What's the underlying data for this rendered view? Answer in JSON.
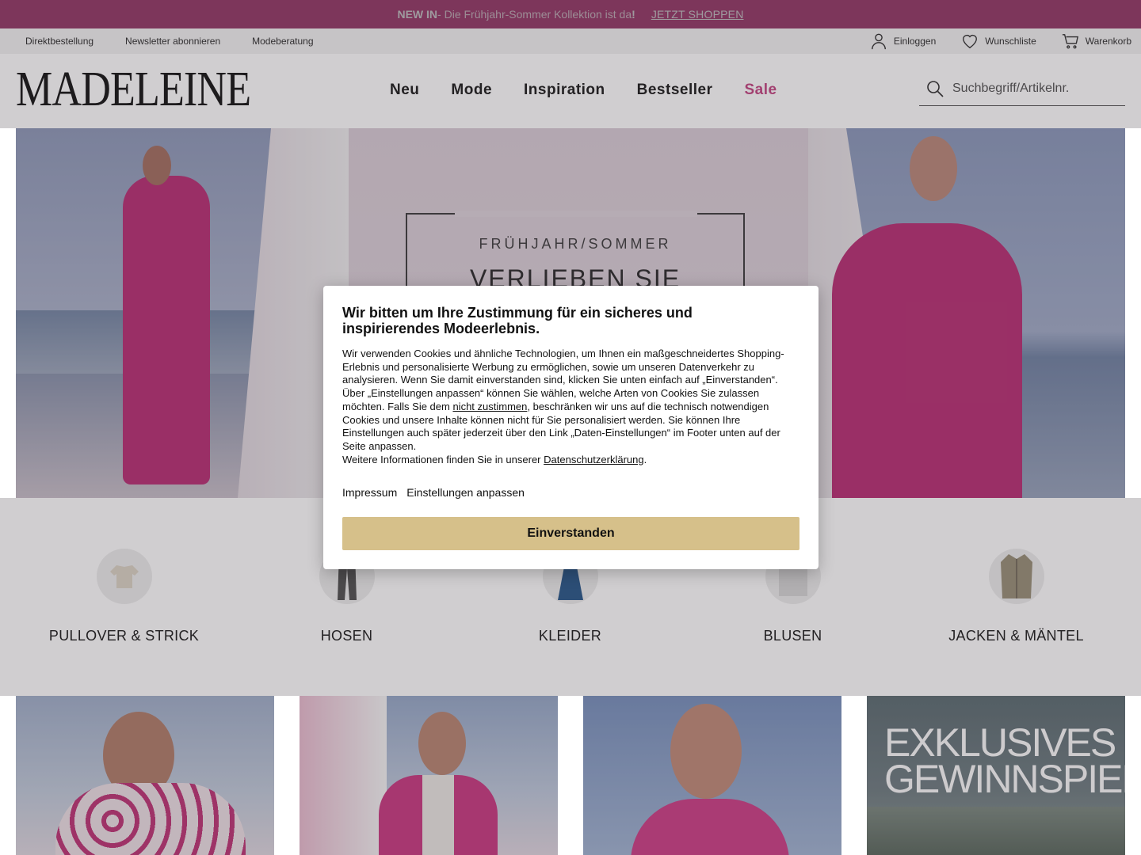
{
  "promo": {
    "new_in": "NEW IN",
    "text": " - Die Frühjahr-Sommer Kollektion ist da",
    "exclamation": "!",
    "cta": "JETZT SHOPPEN"
  },
  "service": {
    "links": [
      "Direktbestellung",
      "Newsletter abonnieren",
      "Modeberatung"
    ],
    "login": "Einloggen",
    "wishlist": "Wunschliste",
    "cart": "Warenkorb"
  },
  "header": {
    "logo": "MADELEINE",
    "nav": [
      "Neu",
      "Mode",
      "Inspiration",
      "Bestseller",
      "Sale"
    ],
    "search_placeholder": "Suchbegriff/Artikelnr."
  },
  "hero": {
    "kicker": "FRÜHJAHR/SOMMER",
    "title": "VERLIEBEN SIE"
  },
  "categories": [
    "PULLOVER & STRICK",
    "HOSEN",
    "KLEIDER",
    "BLUSEN",
    "JACKEN & MÄNTEL"
  ],
  "tiles": {
    "promo_line1": "EXKLUSIVES",
    "promo_line2": "GEWINNSPIEL"
  },
  "consent": {
    "title": "Wir bitten um Ihre Zustimmung für ein sicheres und inspirierendes Modeerlebnis.",
    "body_1": "Wir verwenden Cookies und ähnliche Technologien, um Ihnen ein maßgeschneidertes Shopping-Erlebnis und personalisierte Werbung zu ermöglichen, sowie um unseren Datenverkehr zu analysieren. Wenn Sie damit einverstanden sind, klicken Sie unten einfach auf „Einverstanden“. Über „Einstellungen anpassen“ können Sie wählen, welche Arten von Cookies Sie zulassen möchten. Falls Sie dem ",
    "reject_link": "nicht zustimmen",
    "body_2": ", beschränken wir uns auf die technisch notwendigen Cookies und unsere Inhalte können nicht für Sie personalisiert werden. Sie können Ihre Einstellungen auch später jederzeit über den Link „Daten-Einstellungen“ im Footer unten auf der Seite anpassen.",
    "body_3": "Weitere Informationen finden Sie in unserer ",
    "privacy_link": "Datenschutzerklärung",
    "body_4": ".",
    "imprint": "Impressum",
    "settings": "Einstellungen anpassen",
    "accept": "Einverstanden"
  },
  "colors": {
    "brand_pink": "#c44a85",
    "accept_button": "#d6c08a"
  }
}
